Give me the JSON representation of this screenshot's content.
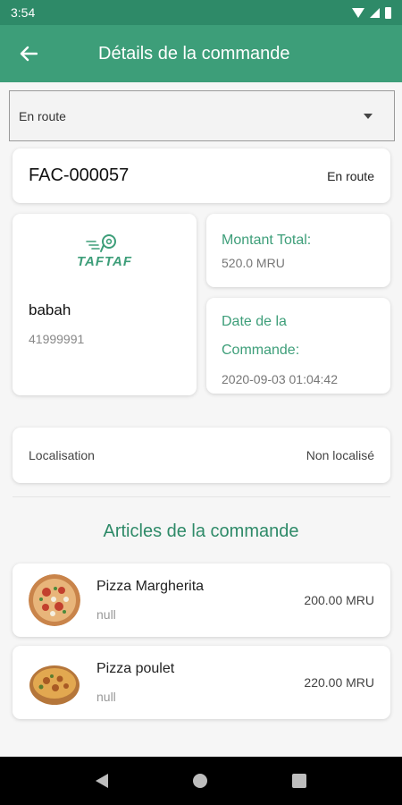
{
  "status_bar": {
    "time": "3:54"
  },
  "app_bar": {
    "title": "Détails de la commande",
    "back_icon": "arrow-back-icon"
  },
  "status_dropdown": {
    "selected": "En route"
  },
  "order": {
    "id": "FAC-000057",
    "status": "En route"
  },
  "customer": {
    "logo_text": "TAFTAF",
    "name": "babah",
    "phone": "41999991"
  },
  "total": {
    "label": "Montant Total:",
    "value": "520.0 MRU"
  },
  "order_date": {
    "label_line1": "Date de la",
    "label_line2": "Commande:",
    "value": "2020-09-03 01:04:42"
  },
  "location": {
    "label": "Localisation",
    "value": "Non localisé"
  },
  "items_section": {
    "title": "Articles de la commande",
    "items": [
      {
        "name": "Pizza Margherita",
        "note": "null",
        "price": "200.00 MRU"
      },
      {
        "name": "Pizza poulet",
        "note": "null",
        "price": "220.00 MRU"
      }
    ]
  },
  "colors": {
    "primary": "#3d9e79",
    "primary_dark": "#2e8a68"
  }
}
